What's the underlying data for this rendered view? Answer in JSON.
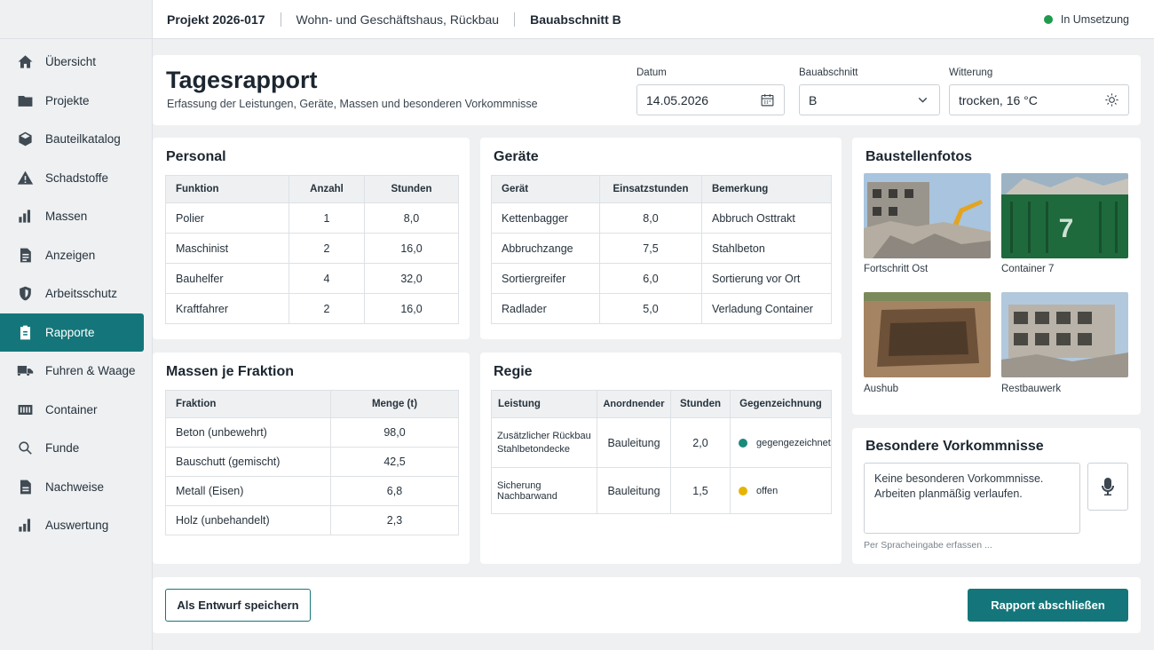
{
  "topbar": {
    "project": "Projekt 2026-017",
    "description": "Wohn- und Geschäftshaus, Rückbau",
    "section": "Bauabschnitt B",
    "status": "In Umsetzung",
    "status_color": "#1f9a4e"
  },
  "sidebar": {
    "items": [
      {
        "label": "Übersicht",
        "icon": "home-icon"
      },
      {
        "label": "Projekte",
        "icon": "folder-icon"
      },
      {
        "label": "Bauteilkatalog",
        "icon": "cube-icon"
      },
      {
        "label": "Schadstoffe",
        "icon": "warning-icon"
      },
      {
        "label": "Massen",
        "icon": "bar-chart-icon"
      },
      {
        "label": "Anzeigen",
        "icon": "document-icon"
      },
      {
        "label": "Arbeitsschutz",
        "icon": "shield-icon"
      },
      {
        "label": "Rapporte",
        "icon": "clipboard-icon",
        "active": true
      },
      {
        "label": "Fuhren & Waage",
        "icon": "truck-icon"
      },
      {
        "label": "Container",
        "icon": "container-icon"
      },
      {
        "label": "Funde",
        "icon": "search-icon"
      },
      {
        "label": "Nachweise",
        "icon": "file-icon"
      },
      {
        "label": "Auswertung",
        "icon": "chart-icon"
      }
    ]
  },
  "header": {
    "title": "Tagesrapport",
    "subtitle": "Erfassung der Leistungen, Geräte, Massen und besonderen Vorkommnisse",
    "date_label": "Datum",
    "date_value": "14.05.2026",
    "section_label": "Bauabschnitt",
    "section_value": "B",
    "weather_label": "Witterung",
    "weather_value": "trocken, 16 °C"
  },
  "personal": {
    "title": "Personal",
    "columns": [
      "Funktion",
      "Anzahl",
      "Stunden"
    ],
    "rows": [
      [
        "Polier",
        "1",
        "8,0"
      ],
      [
        "Maschinist",
        "2",
        "16,0"
      ],
      [
        "Bauhelfer",
        "4",
        "32,0"
      ],
      [
        "Kraftfahrer",
        "2",
        "16,0"
      ]
    ]
  },
  "geraete": {
    "title": "Geräte",
    "columns": [
      "Gerät",
      "Einsatzstunden",
      "Bemerkung"
    ],
    "rows": [
      [
        "Kettenbagger",
        "8,0",
        "Abbruch Osttrakt"
      ],
      [
        "Abbruchzange",
        "7,5",
        "Stahlbeton"
      ],
      [
        "Sortiergreifer",
        "6,0",
        "Sortierung vor Ort"
      ],
      [
        "Radlader",
        "5,0",
        "Verladung Container"
      ]
    ]
  },
  "massen": {
    "title": "Massen je Fraktion",
    "columns": [
      "Fraktion",
      "Menge (t)"
    ],
    "rows": [
      [
        "Beton (unbewehrt)",
        "98,0"
      ],
      [
        "Bauschutt (gemischt)",
        "42,5"
      ],
      [
        "Metall (Eisen)",
        "6,8"
      ],
      [
        "Holz (unbehandelt)",
        "2,3"
      ]
    ]
  },
  "regie": {
    "title": "Regie",
    "columns": [
      "Leistung",
      "Anordnender",
      "Stunden",
      "Gegenzeichnung"
    ],
    "rows": [
      {
        "leistung": "Zusätzlicher Rückbau Stahlbetondecke",
        "anordnender": "Bauleitung",
        "stunden": "2,0",
        "status": "gegengezeichnet",
        "color": "#1b8a7a"
      },
      {
        "leistung": "Sicherung Nachbarwand",
        "anordnender": "Bauleitung",
        "stunden": "1,5",
        "status": "offen",
        "color": "#e6b400"
      }
    ]
  },
  "fotos": {
    "title": "Baustellenfotos",
    "items": [
      {
        "caption": "Fortschritt Ost"
      },
      {
        "caption": "Container 7",
        "label": "7"
      },
      {
        "caption": "Aushub"
      },
      {
        "caption": "Restbauwerk"
      }
    ]
  },
  "vorkommnisse": {
    "title": "Besondere Vorkommnisse",
    "text": "Keine besonderen Vorkommnisse. Arbeiten planmäßig verlaufen.",
    "hint": "Per Spracheingabe erfassen ..."
  },
  "footer": {
    "draft_label": "Als Entwurf speichern",
    "close_label": "Rapport abschließen"
  },
  "colors": {
    "accent": "#14767a"
  }
}
